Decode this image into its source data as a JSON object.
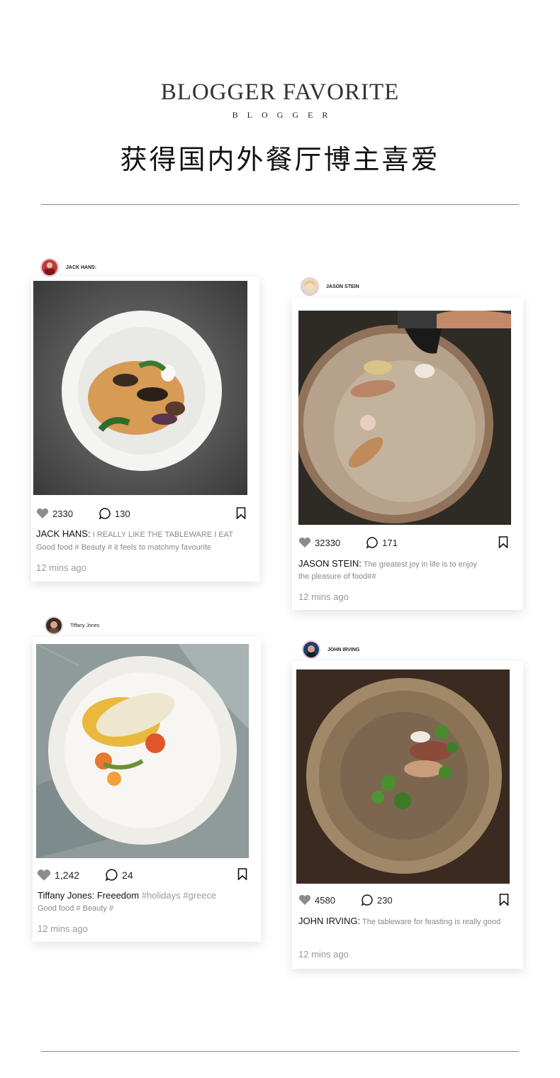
{
  "header": {
    "title_en": "BLOGGER FAVORITE",
    "subtitle": "BLOGGER",
    "title_cn": "获得国内外餐厅博主喜爱"
  },
  "posts": [
    {
      "author": "JACK HANS:",
      "likes": "2330",
      "comments": "130",
      "caption_name": "JACK HANS:",
      "caption_text": "I REALLY LIKE THE TABLEWARE I EAT",
      "caption_line2": "Good food # Beauty #    it feels to matchmy favourite",
      "time": "12 mins ago"
    },
    {
      "author": "JASON STEIN",
      "likes": "32330",
      "comments": "171",
      "caption_name": "JASON STEIN:",
      "caption_text": "The greatest joy in life is to enjoy",
      "caption_line2": "the pleasure of food##",
      "time": "12 mins ago"
    },
    {
      "author": "Tiffany Jones",
      "likes": "1,242",
      "comments": "24",
      "caption_name": "Tiffany Jones:",
      "caption_text": "Freeedom",
      "caption_tags": "#holidays #greece",
      "caption_line2": "Good food # Beauty #",
      "time": "12 mins ago"
    },
    {
      "author": "JOHN IRVING",
      "likes": "4580",
      "comments": "230",
      "caption_name": "JOHN IRVING:",
      "caption_text": "The tableware for feasting is really good",
      "time": "12 mins ago"
    }
  ],
  "icons": {
    "like": "heart-icon",
    "comment": "speech-bubble-icon",
    "save": "bookmark-icon"
  },
  "colors": {
    "rule": "#8a8a8a",
    "heart": "#8c8c8c",
    "muted_text": "#999999"
  }
}
